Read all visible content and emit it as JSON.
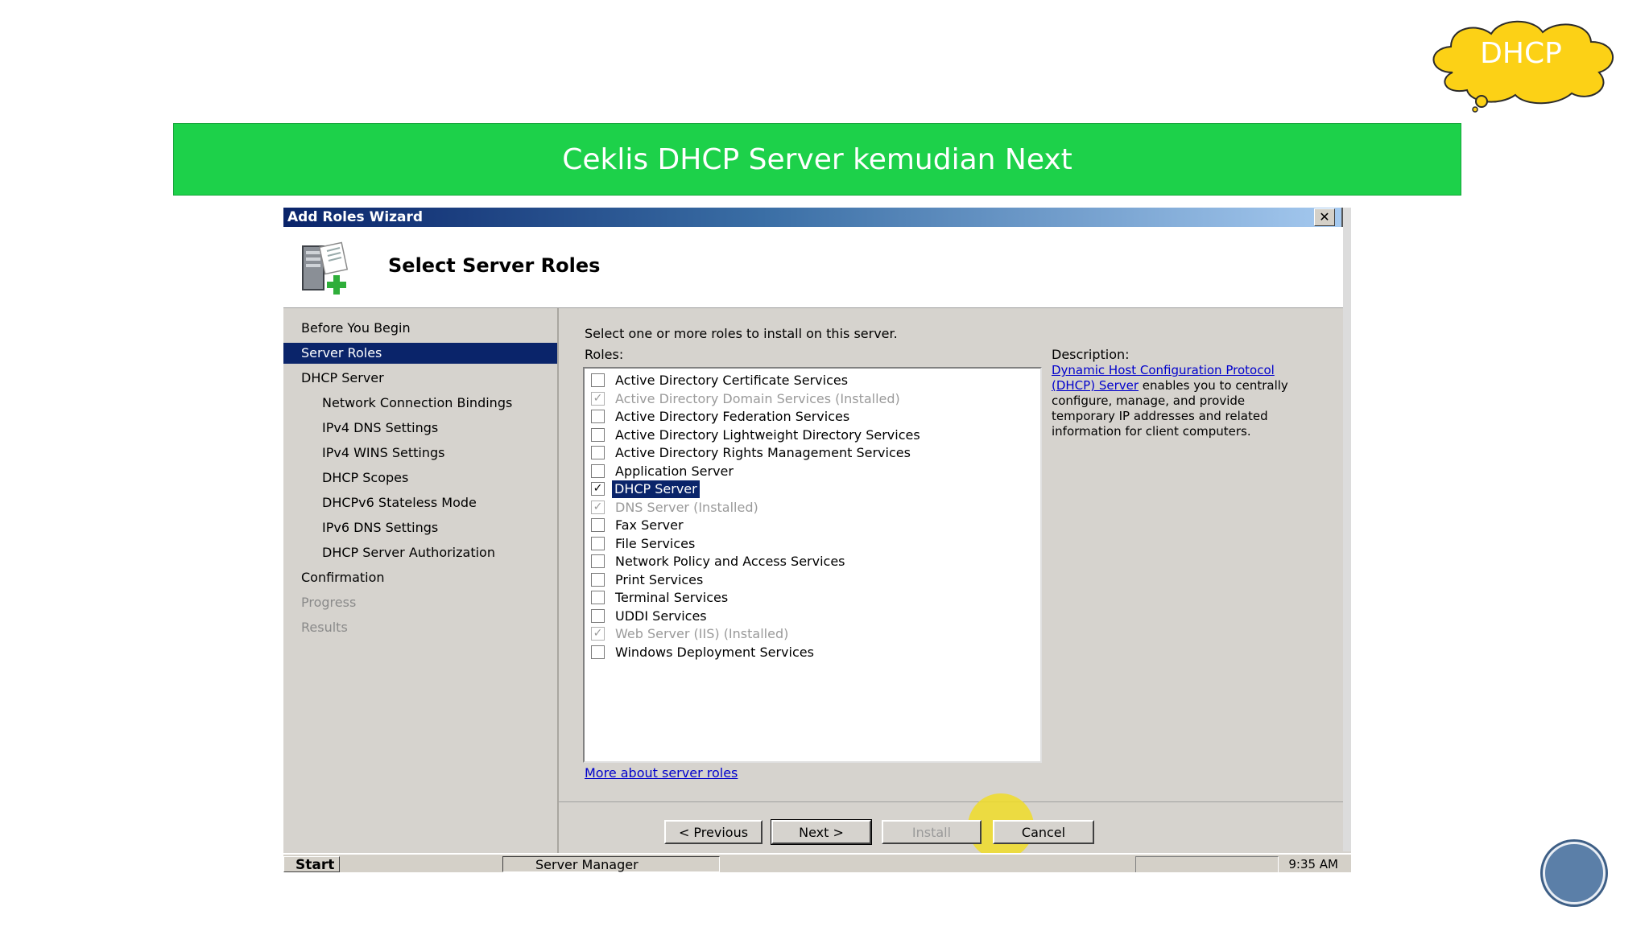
{
  "badge": {
    "label": "DHCP",
    "color": "#fcd116"
  },
  "banner": {
    "text": "Ceklis DHCP Server kemudian Next",
    "color": "#1dd14a"
  },
  "window": {
    "title": "Add Roles Wizard",
    "close_label": "✕",
    "page_title": "Select Server Roles",
    "icon": "server-add-icon"
  },
  "nav": {
    "items": [
      {
        "label": "Before You Begin",
        "level": 0,
        "state": "normal"
      },
      {
        "label": "Server Roles",
        "level": 0,
        "state": "active"
      },
      {
        "label": "DHCP Server",
        "level": 0,
        "state": "normal"
      },
      {
        "label": "Network Connection Bindings",
        "level": 1,
        "state": "normal"
      },
      {
        "label": "IPv4 DNS Settings",
        "level": 1,
        "state": "normal"
      },
      {
        "label": "IPv4 WINS Settings",
        "level": 1,
        "state": "normal"
      },
      {
        "label": "DHCP Scopes",
        "level": 1,
        "state": "normal"
      },
      {
        "label": "DHCPv6 Stateless Mode",
        "level": 1,
        "state": "normal"
      },
      {
        "label": "IPv6 DNS Settings",
        "level": 1,
        "state": "normal"
      },
      {
        "label": "DHCP Server Authorization",
        "level": 1,
        "state": "normal"
      },
      {
        "label": "Confirmation",
        "level": 0,
        "state": "normal"
      },
      {
        "label": "Progress",
        "level": 0,
        "state": "dim"
      },
      {
        "label": "Results",
        "level": 0,
        "state": "dim"
      }
    ]
  },
  "main": {
    "instruction": "Select one or more roles to install on this server.",
    "roles_label": "Roles:",
    "roles": [
      {
        "label": "Active Directory Certificate Services",
        "checked": false,
        "dim": false
      },
      {
        "label": "Active Directory Domain Services  (Installed)",
        "checked": true,
        "dim": true
      },
      {
        "label": "Active Directory Federation Services",
        "checked": false,
        "dim": false
      },
      {
        "label": "Active Directory Lightweight Directory Services",
        "checked": false,
        "dim": false
      },
      {
        "label": "Active Directory Rights Management Services",
        "checked": false,
        "dim": false
      },
      {
        "label": "Application Server",
        "checked": false,
        "dim": false
      },
      {
        "label": "DHCP Server",
        "checked": true,
        "dim": false,
        "selected": true
      },
      {
        "label": "DNS Server  (Installed)",
        "checked": true,
        "dim": true
      },
      {
        "label": "Fax Server",
        "checked": false,
        "dim": false
      },
      {
        "label": "File Services",
        "checked": false,
        "dim": false
      },
      {
        "label": "Network Policy and Access Services",
        "checked": false,
        "dim": false
      },
      {
        "label": "Print Services",
        "checked": false,
        "dim": false
      },
      {
        "label": "Terminal Services",
        "checked": false,
        "dim": false
      },
      {
        "label": "UDDI Services",
        "checked": false,
        "dim": false
      },
      {
        "label": "Web Server (IIS)  (Installed)",
        "checked": true,
        "dim": true
      },
      {
        "label": "Windows Deployment Services",
        "checked": false,
        "dim": false
      }
    ],
    "more_link": "More about server roles",
    "description_label": "Description:",
    "description_link": "Dynamic Host Configuration Protocol (DHCP) Server",
    "description_text": " enables you to centrally configure, manage, and provide temporary IP addresses and related information for client computers."
  },
  "buttons": {
    "previous": "< Previous",
    "next": "Next >",
    "install": "Install",
    "cancel": "Cancel"
  },
  "taskbar": {
    "start": "Start",
    "app": "Server Manager",
    "clock": "9:35 AM"
  }
}
